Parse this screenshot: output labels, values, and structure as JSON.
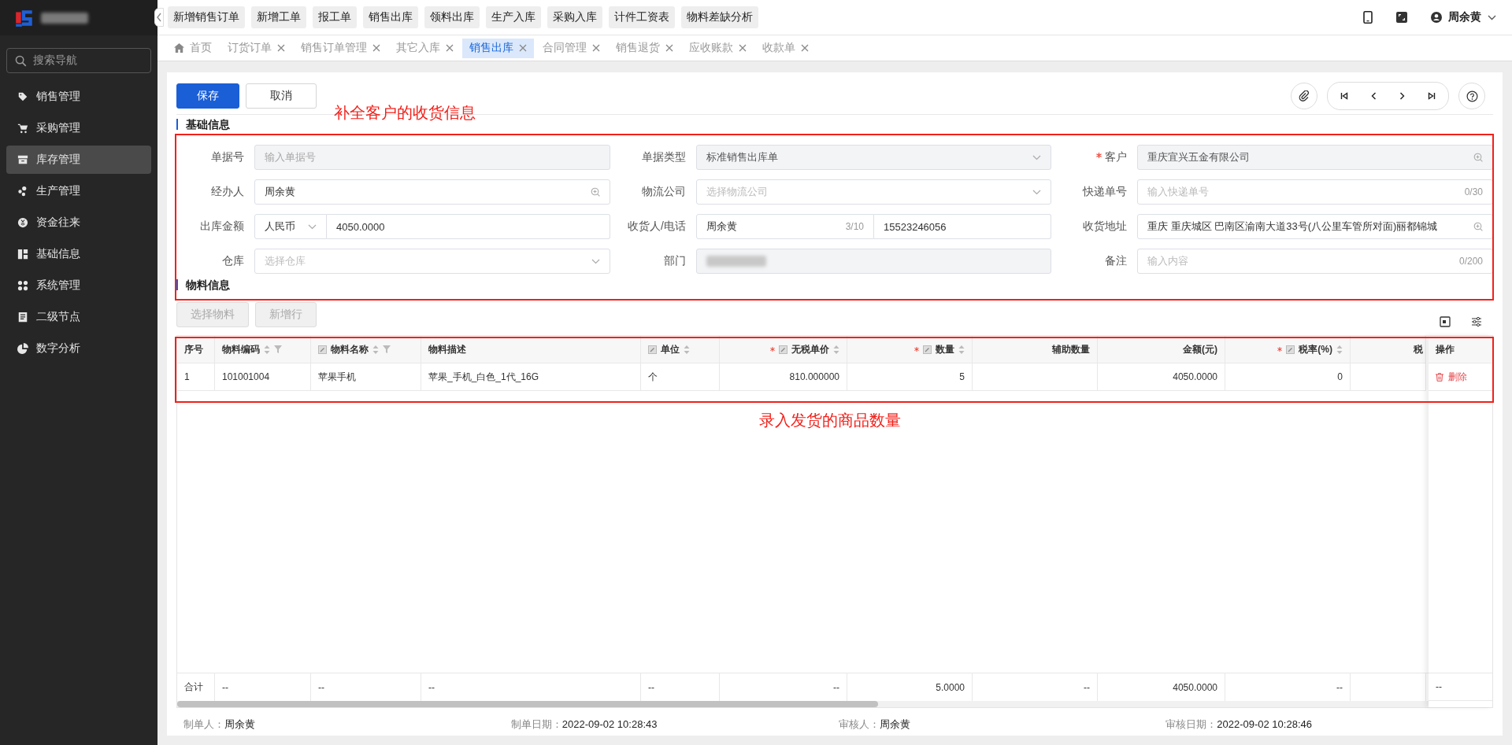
{
  "sidebar": {
    "search": {
      "placeholder": "搜索导航"
    },
    "items": [
      {
        "label": "销售管理",
        "selected": false
      },
      {
        "label": "采购管理",
        "selected": false
      },
      {
        "label": "库存管理",
        "selected": true
      },
      {
        "label": "生产管理",
        "selected": false
      },
      {
        "label": "资金往来",
        "selected": false
      },
      {
        "label": "基础信息",
        "selected": false
      },
      {
        "label": "系统管理",
        "selected": false
      },
      {
        "label": "二级节点",
        "selected": false
      },
      {
        "label": "数字分析",
        "selected": false
      }
    ]
  },
  "quick_buttons": [
    "新增销售订单",
    "新增工单",
    "报工单",
    "销售出库",
    "领料出库",
    "生产入库",
    "采购入库",
    "计件工资表",
    "物料差缺分析"
  ],
  "header": {
    "user": "周余黄"
  },
  "tabs": [
    {
      "label": "首页",
      "selected": false,
      "closable": false
    },
    {
      "label": "订货订单",
      "selected": false,
      "closable": true
    },
    {
      "label": "销售订单管理",
      "selected": false,
      "closable": true
    },
    {
      "label": "其它入库",
      "selected": false,
      "closable": true
    },
    {
      "label": "销售出库",
      "selected": true,
      "closable": true
    },
    {
      "label": "合同管理",
      "selected": false,
      "closable": true
    },
    {
      "label": "销售退货",
      "selected": false,
      "closable": true
    },
    {
      "label": "应收账款",
      "selected": false,
      "closable": true
    },
    {
      "label": "收款单",
      "selected": false,
      "closable": true
    }
  ],
  "toolbar": {
    "buttons": [
      {
        "label": "保存",
        "kind": "primary"
      },
      {
        "label": "取消",
        "kind": "default"
      }
    ]
  },
  "annotations": [
    {
      "text": "补全客户的收货信息"
    },
    {
      "text": "录入发货的商品数量"
    }
  ],
  "sections": [
    "基础信息",
    "物料信息"
  ],
  "form": {
    "fields": [
      {
        "label": "单据号",
        "kind": "input",
        "required": false,
        "disabled": true,
        "placeholder": "输入单据号"
      },
      {
        "label": "单据类型",
        "kind": "select",
        "required": false,
        "disabled": true,
        "value": "标准销售出库单"
      },
      {
        "label": "客户",
        "kind": "lookup",
        "required": true,
        "disabled": true,
        "value": "重庆宜兴五金有限公司"
      },
      {
        "label": "经办人",
        "kind": "lookup",
        "required": false,
        "disabled": false,
        "value": "周余黄"
      },
      {
        "label": "物流公司",
        "kind": "select",
        "required": false,
        "disabled": false,
        "placeholder": "选择物流公司"
      },
      {
        "label": "快递单号",
        "kind": "input",
        "required": false,
        "disabled": false,
        "placeholder": "输入快递单号",
        "counter": "0/30"
      },
      {
        "label": "出库金额",
        "kind": "currency",
        "required": false,
        "disabled": false,
        "currency": "人民币",
        "value": "4050.0000"
      },
      {
        "label": "收货人/电话",
        "kind": "contact",
        "required": false,
        "disabled": false,
        "value": "周余黄",
        "counter": "3/10",
        "phone": "15523246056"
      },
      {
        "label": "收货地址",
        "kind": "lookup",
        "required": false,
        "disabled": false,
        "value": "重庆 重庆城区 巴南区渝南大道33号(八公里车管所对面)丽都锦城"
      },
      {
        "label": "仓库",
        "kind": "select",
        "required": false,
        "disabled": false,
        "placeholder": "选择仓库"
      },
      {
        "label": "部门",
        "kind": "redacted",
        "required": false,
        "disabled": true
      },
      {
        "label": "备注",
        "kind": "input",
        "required": false,
        "disabled": false,
        "placeholder": "输入内容",
        "counter": "0/200"
      }
    ]
  },
  "material_buttons": [
    {
      "label": "选择物料",
      "disabled": true
    },
    {
      "label": "新增行",
      "disabled": true
    }
  ],
  "table": {
    "columns": [
      {
        "label": "序号",
        "required": false,
        "editable": false,
        "sortable": false,
        "filterable": false
      },
      {
        "label": "物料编码",
        "required": false,
        "editable": false,
        "sortable": true,
        "filterable": true
      },
      {
        "label": "物料名称",
        "required": false,
        "editable": true,
        "sortable": true,
        "filterable": true
      },
      {
        "label": "物料描述",
        "required": false,
        "editable": false,
        "sortable": false,
        "filterable": false
      },
      {
        "label": "单位",
        "required": false,
        "editable": true,
        "sortable": true,
        "filterable": false
      },
      {
        "label": "无税单价",
        "required": true,
        "editable": true,
        "sortable": true,
        "filterable": false
      },
      {
        "label": "数量",
        "required": true,
        "editable": true,
        "sortable": true,
        "filterable": false
      },
      {
        "label": "辅助数量",
        "required": false,
        "editable": false,
        "sortable": false,
        "filterable": false
      },
      {
        "label": "金额(元)",
        "required": false,
        "editable": false,
        "sortable": false,
        "filterable": false
      },
      {
        "label": "税率(%)",
        "required": true,
        "editable": true,
        "sortable": true,
        "filterable": false
      },
      {
        "label": "税",
        "required": false,
        "editable": false,
        "sortable": false,
        "filterable": false
      }
    ],
    "action_column": "操作",
    "rows": [
      {
        "cells": [
          "1",
          "101001004",
          "苹果手机",
          "苹果_手机_白色_1代_16G",
          "个",
          "810.000000",
          "5",
          "",
          "4050.0000",
          "0"
        ],
        "action": "删除"
      }
    ],
    "summary": {
      "cells": [
        "合计",
        "--",
        "--",
        "--",
        "--",
        "--",
        "5.0000",
        "--",
        "4050.0000",
        "--"
      ],
      "action": "--"
    }
  },
  "footer": [
    {
      "label": "制单人：",
      "value": "周余黄"
    },
    {
      "label": "制单日期：",
      "value": "2022-09-02 10:28:43"
    },
    {
      "label": "审核人：",
      "value": "周余黄"
    },
    {
      "label": "审核日期：",
      "value": "2022-09-02 10:28:46"
    }
  ]
}
